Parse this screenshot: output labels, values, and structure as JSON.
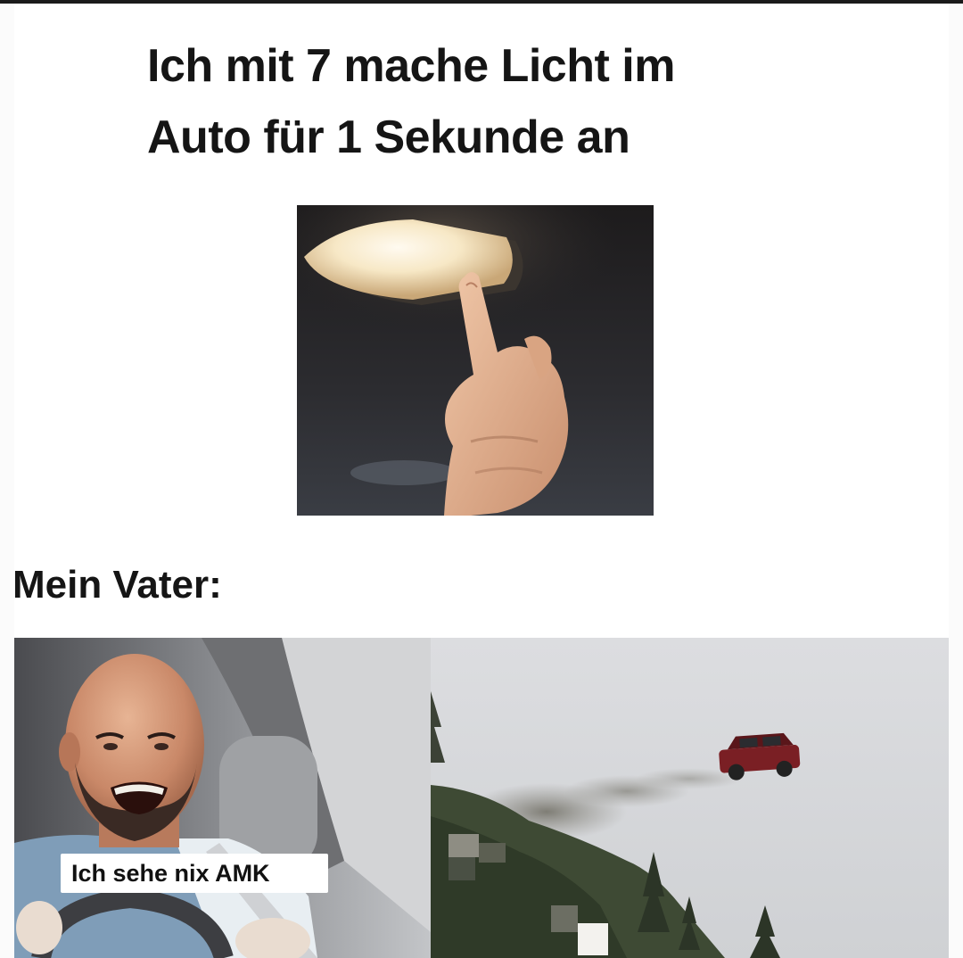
{
  "meme": {
    "title_line1": "Ich mit 7 mache Licht im",
    "title_line2": "Auto für 1 Sekunde an",
    "label_father": "Mein Vater:",
    "caption": "Ich sehe nix AMK"
  },
  "colors": {
    "text": "#151515",
    "background": "#ffffff",
    "car_red": "#7a1f24",
    "lamp_glow": "#f7e8c6"
  },
  "images": [
    {
      "name": "car-interior-light-photo",
      "icon": "finger-touching-light"
    },
    {
      "name": "angry-driver-photo",
      "icon": "bald-man-driving"
    },
    {
      "name": "flying-car-photo",
      "icon": "car-launching-off-cliff"
    }
  ]
}
